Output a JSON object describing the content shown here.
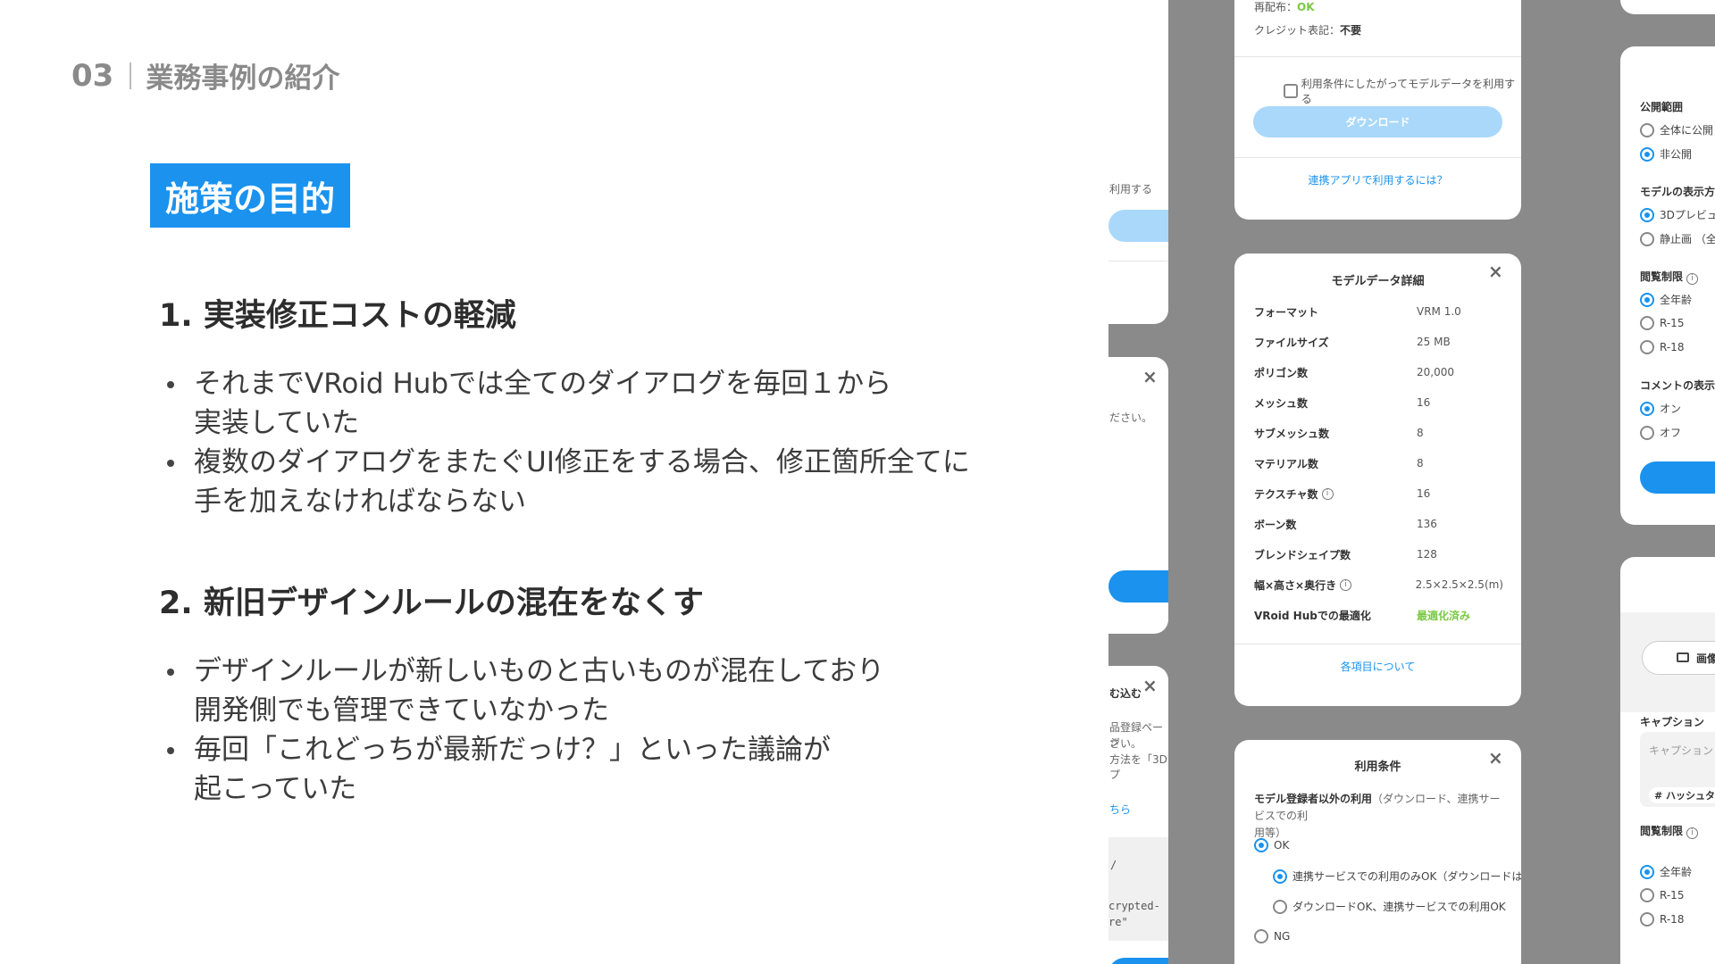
{
  "header": {
    "number": "03",
    "title": "業務事例の紹介"
  },
  "tag": "施策の目的",
  "sections": [
    {
      "heading": "1. 実装修正コストの軽減",
      "bullets": [
        [
          "それまでVRoid Hubでは全てのダイアログを毎回１から",
          "実装していた"
        ],
        [
          "複数のダイアログをまたぐUI修正をする場合、修正箇所全てに",
          "手を加えなければならない"
        ]
      ]
    },
    {
      "heading": "2. 新旧デザインルールの混在をなくす",
      "bullets": [
        [
          "デザインルールが新しいものと古いものが混在しており",
          "開発側でも管理できていなかった"
        ],
        [
          "毎回「これどっちが最新だっけ？」といった議論が",
          "起こっていた"
        ]
      ]
    }
  ],
  "mock_left": {
    "t1": "利用する",
    "t2": "ださい。",
    "t3": "む込む",
    "t4": "品登録ページ",
    "t5": "さい。",
    "t6": "方法を「3Dプ",
    "t7": "ちら",
    "t8": "/",
    "t9": "crypted-",
    "t10": "re\""
  },
  "download_card": {
    "redistribution_label": "再配布：",
    "redistribution_value": "OK",
    "credit_label": "クレジット表記：",
    "credit_value": "不要",
    "agree_checkbox": "利用条件にしたがってモデルデータを利用する",
    "download_button": "ダウンロード",
    "linked_app_link": "連携アプリで利用するには？"
  },
  "detail_card": {
    "title": "モデルデータ詳細",
    "rows": [
      {
        "label": "フォーマット",
        "value": "VRM 1.0"
      },
      {
        "label": "ファイルサイズ",
        "value": "25 MB"
      },
      {
        "label": "ポリゴン数",
        "value": "20,000"
      },
      {
        "label": "メッシュ数",
        "value": "16"
      },
      {
        "label": "サブメッシュ数",
        "value": "8"
      },
      {
        "label": "マテリアル数",
        "value": "8"
      },
      {
        "label": "テクスチャ数",
        "value": "16"
      },
      {
        "label": "ボーン数",
        "value": "136"
      },
      {
        "label": "ブレンドシェイプ数",
        "value": "128"
      },
      {
        "label": "幅×高さ×奥行き",
        "value": "2.5×2.5×2.5(m)"
      },
      {
        "label": "VRoid Hubでの最適化",
        "value": "最適化済み"
      }
    ],
    "footer_link": "各項目について"
  },
  "terms_card": {
    "title": "利用条件",
    "desc_bold": "モデル登録者以外の利用",
    "desc_rest": "（ダウンロード、連携サービスでの利",
    "desc_line2": "用等）",
    "opt_ok": "OK",
    "opt_sub1": "連携サービスでの利用のみOK（ダウンロードはNG）",
    "opt_sub2": "ダウンロードOK、連携サービスでの利用OK",
    "opt_ng": "NG"
  },
  "settings_card": {
    "visibility_label": "公開範囲",
    "vis_opt1": "全体に公開",
    "vis_opt2": "非公開",
    "display_label": "モデルの表示方",
    "disp_opt1": "3Dプレビュ",
    "disp_opt2": "静止画 （全",
    "rating_label": "閲覧制限",
    "rating_opt1": "全年齢",
    "rating_opt2": "R-15",
    "rating_opt3": "R-18",
    "comment_label": "コメントの表示",
    "comment_opt1": "オン",
    "comment_opt2": "オフ"
  },
  "post_card": {
    "image_button": "画像",
    "caption_label": "キャプション",
    "caption_placeholder": "キャプション",
    "hashtag_button": "# ハッシュタ",
    "rating_label": "閲覧制限",
    "rating_opt1": "全年齢",
    "rating_opt2": "R-15",
    "rating_opt3": "R-18"
  },
  "colors": {
    "accent": "#1a92ee",
    "success": "#7ac943",
    "mock_bg": "#8a8a8a",
    "button_disabled": "#a9d8fb"
  }
}
